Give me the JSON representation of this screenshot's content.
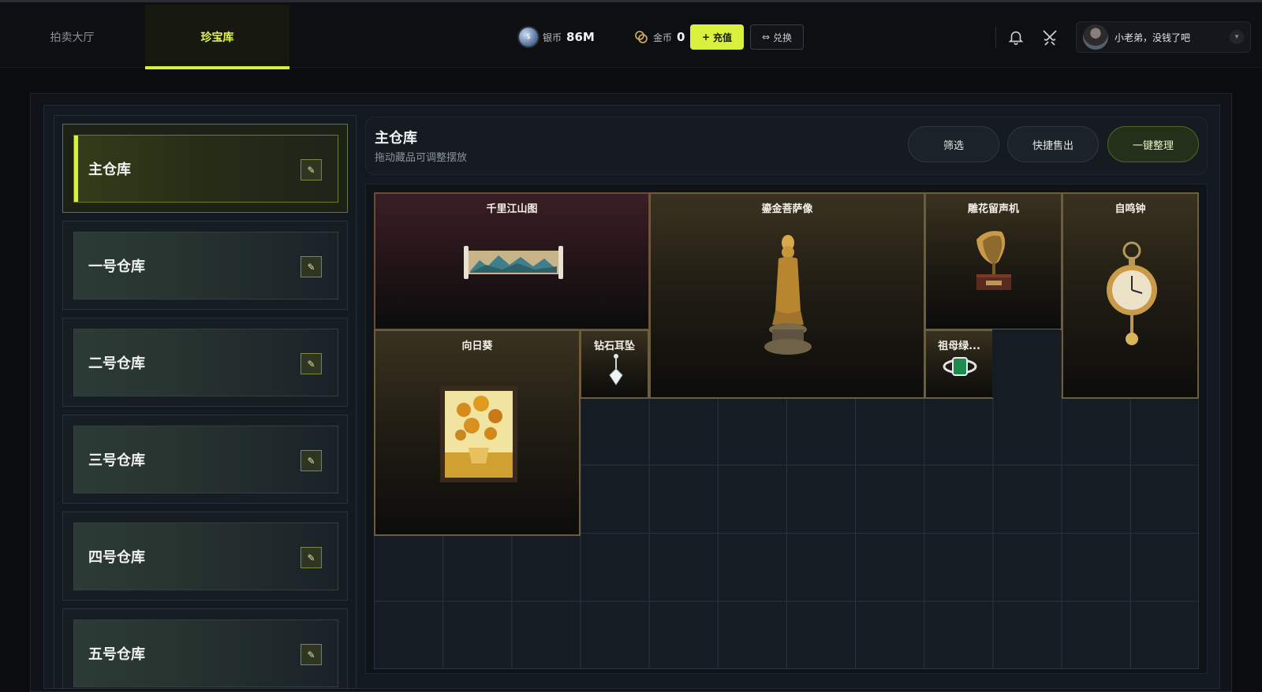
{
  "tabs": [
    {
      "label": "拍卖大厅",
      "active": false
    },
    {
      "label": "珍宝库",
      "active": true
    }
  ],
  "currency": {
    "silver_glyph": "$",
    "silver_label": "银币",
    "silver_value": "86M",
    "gold_label": "金币",
    "gold_value": "0",
    "recharge_label": "充值",
    "exchange_label": "兑换"
  },
  "user": {
    "name": "小老弟，没钱了吧"
  },
  "sidebar": {
    "warehouses": [
      {
        "label": "主仓库",
        "active": true
      },
      {
        "label": "一号仓库",
        "active": false
      },
      {
        "label": "二号仓库",
        "active": false
      },
      {
        "label": "三号仓库",
        "active": false
      },
      {
        "label": "四号仓库",
        "active": false
      },
      {
        "label": "五号仓库",
        "active": false
      }
    ]
  },
  "panel": {
    "title": "主仓库",
    "subtitle": "拖动藏品可调整摆放",
    "filter_label": "筛选",
    "quick_sell_label": "快捷售出",
    "organize_label": "一键整理"
  },
  "items": [
    {
      "name": "千里江山图",
      "icon": "scroll-painting"
    },
    {
      "name": "鎏金菩萨像",
      "icon": "gilded-statue"
    },
    {
      "name": "雕花留声机",
      "icon": "gramophone"
    },
    {
      "name": "自鸣钟",
      "icon": "pocket-clock"
    },
    {
      "name": "向日葵",
      "icon": "sunflower-painting"
    },
    {
      "name": "钻石耳坠",
      "icon": "diamond-earring"
    },
    {
      "name": "祖母绿...",
      "icon": "emerald-ring"
    }
  ],
  "colors": {
    "accent": "#d9f03d",
    "item_border": "#6e5d3a"
  }
}
